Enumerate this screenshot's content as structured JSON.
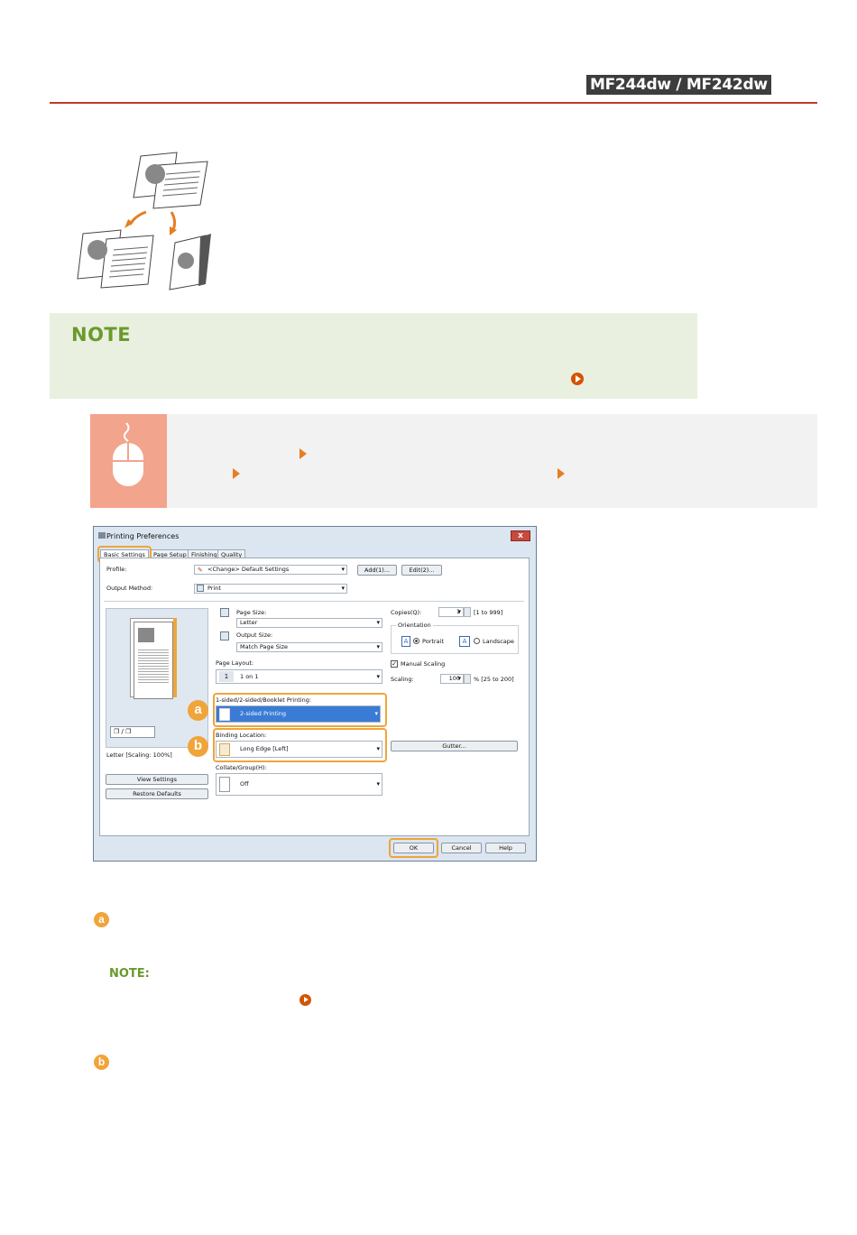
{
  "header": {
    "model_badge": "MF244dw / MF242dw"
  },
  "note": {
    "title": "NOTE"
  },
  "dialog": {
    "title": "Printing Preferences",
    "close_label": "x",
    "tabs": [
      "Basic Settings",
      "Page Setup",
      "Finishing",
      "Quality"
    ],
    "profile": {
      "label": "Profile:",
      "value": "<Change> Default Settings",
      "add_button": "Add(1)...",
      "edit_button": "Edit(2)..."
    },
    "output_method": {
      "label": "Output Method:",
      "value": "Print"
    },
    "page_size": {
      "label": "Page Size:",
      "value": "Letter"
    },
    "output_size": {
      "label": "Output Size:",
      "value": "Match Page Size"
    },
    "page_layout": {
      "label": "Page Layout:",
      "value": "1 on 1"
    },
    "sided": {
      "label": "1-sided/2-sided/Booklet Printing:",
      "value": "2-sided Printing"
    },
    "binding": {
      "label": "Binding Location:",
      "value": "Long Edge [Left]"
    },
    "collate": {
      "label": "Collate/Group(H):",
      "value": "Off"
    },
    "copies": {
      "label": "Copies(Q):",
      "value": "1",
      "range": "[1 to 999]"
    },
    "orientation": {
      "label": "Orientation",
      "portrait": "Portrait",
      "landscape": "Landscape"
    },
    "manual_scaling": {
      "label": "Manual Scaling",
      "scaling_label": "Scaling:",
      "value": "100",
      "range": "% [25 to 200]"
    },
    "gutter_button": "Gutter...",
    "preview_caption": "Letter [Scaling: 100%]",
    "view_settings_button": "View Settings",
    "restore_defaults_button": "Restore Defaults",
    "ok_button": "OK",
    "cancel_button": "Cancel",
    "help_button": "Help",
    "badge_a": "a",
    "badge_b": "b"
  },
  "items": {
    "a": "a",
    "b": "b",
    "note_label": "NOTE:"
  },
  "colors": {
    "accent": "#f0a43a",
    "rule": "#c0392b",
    "note_green": "#6a9a2c",
    "link": "#d35400"
  }
}
